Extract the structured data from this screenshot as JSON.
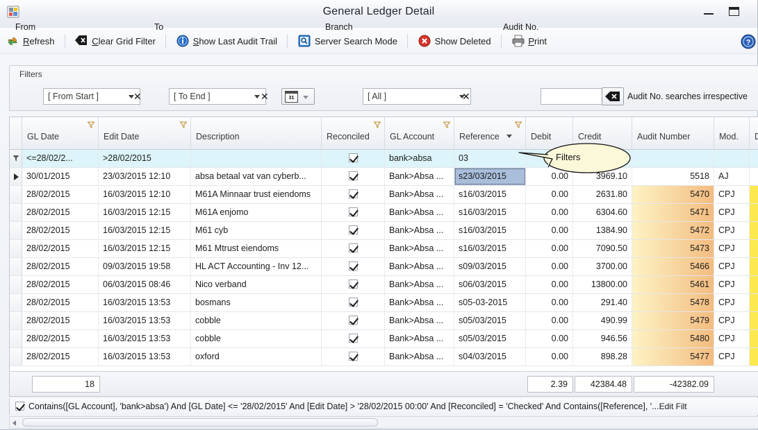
{
  "window": {
    "title": "General Ledger Detail",
    "app_icon": "app-window-icon",
    "minimize_label": "Minimize",
    "maximize_label": "Maximize"
  },
  "toolbar": {
    "items": [
      {
        "label": "Refresh",
        "accel": "R",
        "icon": "refresh-icon"
      },
      {
        "label": "Clear Grid Filter",
        "accel": "C",
        "icon": "clear-filter-icon"
      },
      {
        "label": "Show Last Audit Trail",
        "accel": "S",
        "icon": "info-icon"
      },
      {
        "label": "Server Search Mode",
        "accel": "",
        "icon": "search-icon"
      },
      {
        "label": "Show Deleted",
        "accel": "",
        "icon": "delete-icon"
      },
      {
        "label": "Print",
        "accel": "P",
        "icon": "printer-icon"
      }
    ],
    "help_icon": "help-icon"
  },
  "filters": {
    "caption": "Filters",
    "from_label": "From",
    "from_value": "[ From Start ]",
    "to_label": "To",
    "to_value": "[ To End ]",
    "clear_glyph": "✕",
    "calendar_icon": "calendar-icon",
    "calendar_day": "31",
    "branch_label": "Branch",
    "branch_value": "[ All ]",
    "audit_label": "Audit No.",
    "audit_value": "",
    "audit_clear_icon": "backspace-icon",
    "audit_note": "Audit No. searches irrespective"
  },
  "grid": {
    "columns": [
      {
        "name": "gl-date",
        "label": "GL Date",
        "filterable": true,
        "sorted": false
      },
      {
        "name": "edit-date",
        "label": "Edit Date",
        "filterable": true,
        "sorted": false
      },
      {
        "name": "description",
        "label": "Description",
        "filterable": false,
        "sorted": false
      },
      {
        "name": "reconciled",
        "label": "Reconciled",
        "filterable": true,
        "sorted": false
      },
      {
        "name": "gl-account",
        "label": "GL Account",
        "filterable": true,
        "sorted": false
      },
      {
        "name": "reference",
        "label": "Reference",
        "filterable": true,
        "sorted": true
      },
      {
        "name": "debit",
        "label": "Debit",
        "filterable": false,
        "sorted": false
      },
      {
        "name": "credit",
        "label": "Credit",
        "filterable": false,
        "sorted": false
      },
      {
        "name": "audit-number",
        "label": "Audit Number",
        "filterable": false,
        "sorted": false
      },
      {
        "name": "mod",
        "label": "Mod.",
        "filterable": false,
        "sorted": false
      },
      {
        "name": "doc",
        "label": "Do",
        "filterable": false,
        "sorted": false
      }
    ],
    "filter_row": {
      "gl_date": "<=28/02/2...",
      "edit_date": ">28/02/2015",
      "description": "",
      "reconciled": "checked",
      "gl_account": "bank>absa",
      "reference": "03",
      "debit": "",
      "credit": "",
      "audit_number": "",
      "mod": "",
      "doc": ""
    },
    "rows": [
      {
        "gl_date": "30/01/2015",
        "edit_date": "23/03/2015 12:10",
        "description": "absa betaal vat van cyberb...",
        "reconciled": "checked",
        "gl_account": "Bank>Absa ...",
        "reference": "s23/03/2015",
        "debit": "0.00",
        "credit": "3969.10",
        "audit_number": "5518",
        "mod": "AJ",
        "current": true,
        "selected_cell": "reference",
        "audit_hl": false,
        "doc_hl": false
      },
      {
        "gl_date": "28/02/2015",
        "edit_date": "16/03/2015 12:10",
        "description": "M61A Minnaar trust eiendoms",
        "reconciled": "checked",
        "gl_account": "Bank>Absa ...",
        "reference": "s16/03/2015",
        "debit": "0.00",
        "credit": "2631.80",
        "audit_number": "5470",
        "mod": "CPJ",
        "current": false,
        "selected_cell": "",
        "audit_hl": true,
        "doc_hl": true
      },
      {
        "gl_date": "28/02/2015",
        "edit_date": "16/03/2015 12:15",
        "description": "M61A enjomo",
        "reconciled": "checked",
        "gl_account": "Bank>Absa ...",
        "reference": "s16/03/2015",
        "debit": "0.00",
        "credit": "6304.60",
        "audit_number": "5471",
        "mod": "CPJ",
        "current": false,
        "selected_cell": "",
        "audit_hl": true,
        "doc_hl": true
      },
      {
        "gl_date": "28/02/2015",
        "edit_date": "16/03/2015 12:15",
        "description": "M61 cyb",
        "reconciled": "checked",
        "gl_account": "Bank>Absa ...",
        "reference": "s16/03/2015",
        "debit": "0.00",
        "credit": "1384.90",
        "audit_number": "5472",
        "mod": "CPJ",
        "current": false,
        "selected_cell": "",
        "audit_hl": true,
        "doc_hl": true
      },
      {
        "gl_date": "28/02/2015",
        "edit_date": "16/03/2015 12:15",
        "description": "M61 Mtrust eiendoms",
        "reconciled": "checked",
        "gl_account": "Bank>Absa ...",
        "reference": "s16/03/2015",
        "debit": "0.00",
        "credit": "7090.50",
        "audit_number": "5473",
        "mod": "CPJ",
        "current": false,
        "selected_cell": "",
        "audit_hl": true,
        "doc_hl": true
      },
      {
        "gl_date": "28/02/2015",
        "edit_date": "09/03/2015 19:58",
        "description": "HL ACT Accounting - Inv 12...",
        "reconciled": "checked",
        "gl_account": "Bank>Absa ...",
        "reference": "s09/03/2015",
        "debit": "0.00",
        "credit": "3700.00",
        "audit_number": "5466",
        "mod": "CPJ",
        "current": false,
        "selected_cell": "",
        "audit_hl": true,
        "doc_hl": true
      },
      {
        "gl_date": "28/02/2015",
        "edit_date": "06/03/2015 08:46",
        "description": "Nico verband",
        "reconciled": "checked",
        "gl_account": "Bank>Absa ...",
        "reference": "s06/03/2015",
        "debit": "0.00",
        "credit": "13800.00",
        "audit_number": "5461",
        "mod": "CPJ",
        "current": false,
        "selected_cell": "",
        "audit_hl": true,
        "doc_hl": true
      },
      {
        "gl_date": "28/02/2015",
        "edit_date": "16/03/2015 13:53",
        "description": "bosmans",
        "reconciled": "checked",
        "gl_account": "Bank>Absa ...",
        "reference": "s05-03-2015",
        "debit": "0.00",
        "credit": "291.40",
        "audit_number": "5478",
        "mod": "CPJ",
        "current": false,
        "selected_cell": "",
        "audit_hl": true,
        "doc_hl": true
      },
      {
        "gl_date": "28/02/2015",
        "edit_date": "16/03/2015 13:53",
        "description": "cobble",
        "reconciled": "checked",
        "gl_account": "Bank>Absa ...",
        "reference": "s05/03/2015",
        "debit": "0.00",
        "credit": "490.99",
        "audit_number": "5479",
        "mod": "CPJ",
        "current": false,
        "selected_cell": "",
        "audit_hl": true,
        "doc_hl": true
      },
      {
        "gl_date": "28/02/2015",
        "edit_date": "16/03/2015 13:53",
        "description": "cobble",
        "reconciled": "checked",
        "gl_account": "Bank>Absa ...",
        "reference": "s05/03/2015",
        "debit": "0.00",
        "credit": "946.56",
        "audit_number": "5480",
        "mod": "CPJ",
        "current": false,
        "selected_cell": "",
        "audit_hl": true,
        "doc_hl": true
      },
      {
        "gl_date": "28/02/2015",
        "edit_date": "16/03/2015 13:53",
        "description": "oxford",
        "reconciled": "checked",
        "gl_account": "Bank>Absa ...",
        "reference": "s04/03/2015",
        "debit": "0.00",
        "credit": "898.28",
        "audit_number": "5477",
        "mod": "CPJ",
        "current": false,
        "selected_cell": "",
        "audit_hl": true,
        "doc_hl": true
      }
    ],
    "summary": {
      "count": "18",
      "debit_total": "2.39",
      "credit_total": "42384.48",
      "balance_total": "-42382.09"
    }
  },
  "filter_bar": {
    "enabled": true,
    "expression": "Contains([GL Account], 'bank>absa') And [GL Date] <= '28/02/2015' And [Edit Date] > '28/02/2015 00:00' And [Reconciled] = 'Checked' And Contains([Reference], '...",
    "edit_link": "Edit Filt"
  },
  "callout": {
    "label": "Filters"
  },
  "colors": {
    "filter_row_bg": "#ddf4fa",
    "audit_highlight_left": "#fdf3c4",
    "audit_highlight_right": "#f3bc80",
    "doc_highlight": "#fce94f",
    "selection": "#a9bedb"
  }
}
